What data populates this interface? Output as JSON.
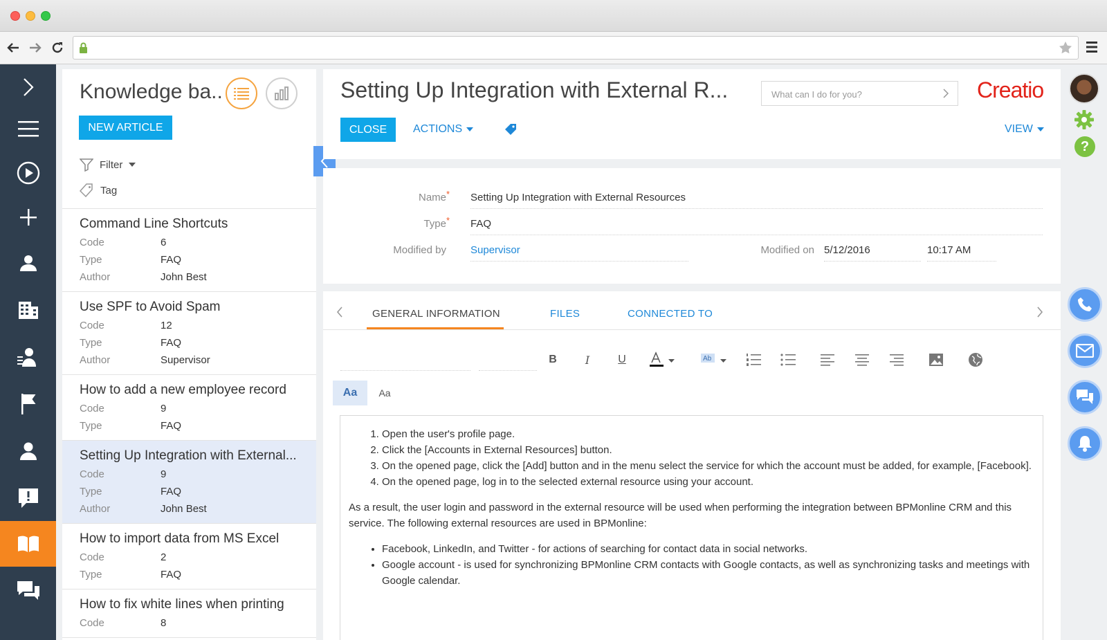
{
  "browser": {
    "url": ""
  },
  "kb": {
    "title": "Knowledge ba..",
    "new_article": "NEW ARTICLE",
    "filter": "Filter",
    "tag": "Tag",
    "labels": {
      "code": "Code",
      "type": "Type",
      "author": "Author"
    },
    "records": [
      {
        "title": "Command Line Shortcuts",
        "code": "6",
        "type": "FAQ",
        "author": "John Best"
      },
      {
        "title": "Use SPF to Avoid Spam",
        "code": "12",
        "type": "FAQ",
        "author": "Supervisor"
      },
      {
        "title": "How to add a new employee record",
        "code": "9",
        "type": "FAQ"
      },
      {
        "title": "Setting Up Integration with External...",
        "code": "9",
        "type": "FAQ",
        "author": "John Best",
        "selected": true
      },
      {
        "title": "How to import data from MS Excel",
        "code": "2",
        "type": "FAQ"
      },
      {
        "title": "How to fix white lines when printing",
        "code": "8"
      }
    ]
  },
  "main": {
    "title": "Setting Up Integration with External R...",
    "search_placeholder": "What can I do for you?",
    "logo": "Creatio",
    "close": "CLOSE",
    "actions": "ACTIONS",
    "view": "VIEW"
  },
  "fields": {
    "name_label": "Name",
    "name_value": "Setting Up Integration with External Resources",
    "type_label": "Type",
    "type_value": "FAQ",
    "modified_by_label": "Modified by",
    "modified_by_value": "Supervisor",
    "modified_on_label": "Modified on",
    "modified_on_date": "5/12/2016",
    "modified_on_time": "10:17 AM"
  },
  "tabs": [
    "GENERAL INFORMATION",
    "FILES",
    "CONNECTED TO"
  ],
  "editor": {
    "fmt_a": "Aa",
    "fmt_b": "Aa",
    "steps": [
      "Open the user's profile page.",
      "Click the [Accounts in External Resources] button.",
      "On the opened page, click the [Add] button and in the menu select the service for which the account must be added, for example, [Facebook].",
      "On the opened page, log in to the selected external resource using your account."
    ],
    "paragraph": "As a result, the user login and password in the external resource will be used when performing the integration between BPMonline CRM and this service. The following external resources are used in BPMonline:",
    "bullets": [
      "Facebook, LinkedIn, and Twitter - for actions of searching for contact data in social networks.",
      "Google account - is used for synchronizing BPMonline CRM contacts with Google contacts, as well as synchronizing tasks and meetings with Google calendar."
    ]
  },
  "colors": {
    "accent": "#0fa6e8",
    "sidebar": "#2f3e4e",
    "active": "#f5861f",
    "link": "#1e88d8"
  }
}
